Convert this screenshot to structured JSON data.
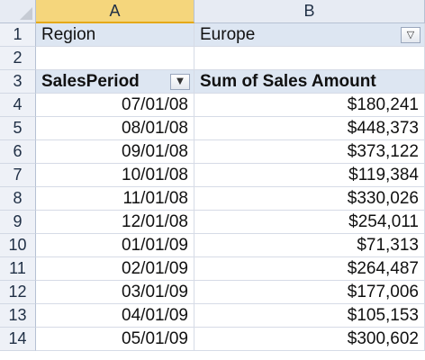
{
  "columns": [
    "A",
    "B"
  ],
  "filter": {
    "row_number": "1",
    "label": "Region",
    "value": "Europe",
    "button_icon": "filter-icon"
  },
  "blank_row_number": "2",
  "pivot_header": {
    "row_number": "3",
    "row_field": "SalesPeriod",
    "value_field": "Sum of Sales Amount",
    "button_icon": "dropdown-arrow-icon"
  },
  "rows": [
    {
      "n": "4",
      "period": "07/01/08",
      "amount": "$180,241"
    },
    {
      "n": "5",
      "period": "08/01/08",
      "amount": "$448,373"
    },
    {
      "n": "6",
      "period": "09/01/08",
      "amount": "$373,122"
    },
    {
      "n": "7",
      "period": "10/01/08",
      "amount": "$119,384"
    },
    {
      "n": "8",
      "period": "11/01/08",
      "amount": "$330,026"
    },
    {
      "n": "9",
      "period": "12/01/08",
      "amount": "$254,011"
    },
    {
      "n": "10",
      "period": "01/01/09",
      "amount": "$71,313"
    },
    {
      "n": "11",
      "period": "02/01/09",
      "amount": "$264,487"
    },
    {
      "n": "12",
      "period": "03/01/09",
      "amount": "$177,006"
    },
    {
      "n": "13",
      "period": "04/01/09",
      "amount": "$105,153"
    },
    {
      "n": "14",
      "period": "05/01/09",
      "amount": "$300,602"
    }
  ],
  "colors": {
    "header_bg": "#e7ebf3",
    "active_column_bg": "#f5d67c",
    "pivot_header_bg": "#dde6f2",
    "gridline": "#d6dbe6"
  }
}
